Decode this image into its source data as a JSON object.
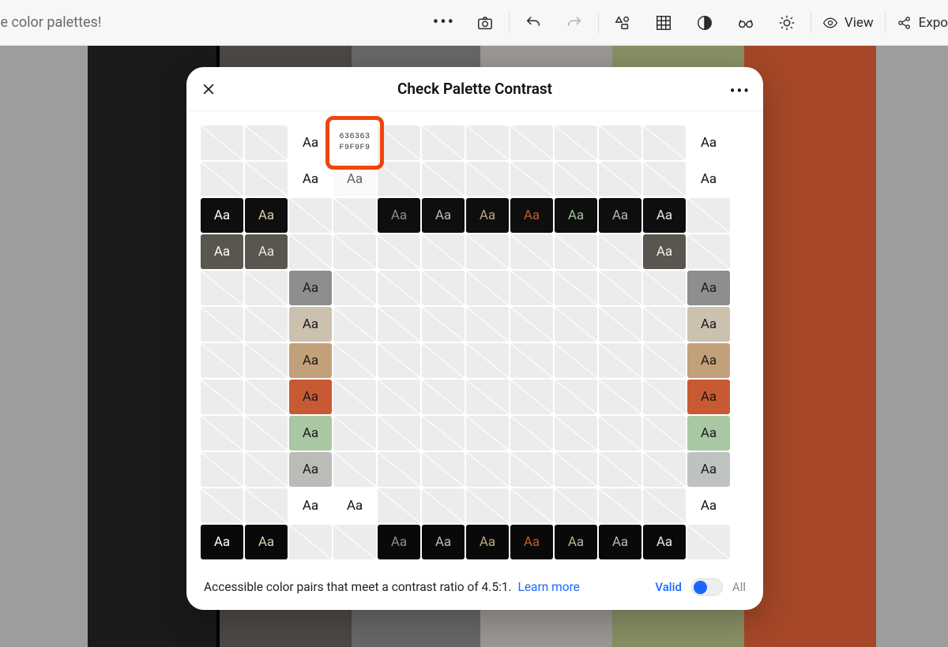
{
  "toolbar": {
    "tagline": "enerate color palettes!",
    "view_label": "View",
    "export_label": "Expo"
  },
  "palette_stripes": [
    {
      "color": "#9d9d9d",
      "width": 111
    },
    {
      "color": "#181a1b",
      "width": 163
    },
    {
      "color": "#000000",
      "width": 4
    },
    {
      "color": "#4c4845",
      "width": 163
    },
    {
      "color": "#464646",
      "width": 4
    },
    {
      "color": "#676767",
      "width": 163
    },
    {
      "color": "#9a9794",
      "width": 167
    },
    {
      "color": "#888f64",
      "width": 167
    },
    {
      "color": "#a54728",
      "width": 167
    },
    {
      "color": "#9d9d9d",
      "width": 120
    }
  ],
  "modal": {
    "title": "Check Palette Contrast",
    "footer_text": "Accessible color pairs that meet a contrast ratio of 4.5:1.",
    "learn_more": "Learn more",
    "valid_label": "Valid",
    "all_label": "All",
    "tooltip": {
      "fg": "636363",
      "bg": "F9F9F9"
    },
    "aa": "Aa"
  },
  "grid": {
    "cols": 12,
    "tooltip_cell": {
      "row": 0,
      "col": 3
    },
    "highlight": {
      "row": 0,
      "col": 3
    },
    "cells": [
      {
        "row": 0,
        "col": 2,
        "bg": "#ffffff",
        "fg": "#111111"
      },
      {
        "row": 0,
        "col": 11,
        "bg": "#ffffff",
        "fg": "#111111"
      },
      {
        "row": 1,
        "col": 2,
        "bg": "#ffffff",
        "fg": "#111111"
      },
      {
        "row": 1,
        "col": 3,
        "bg": "#f9f9f9",
        "fg": "#636363"
      },
      {
        "row": 1,
        "col": 11,
        "bg": "#ffffff",
        "fg": "#111111"
      },
      {
        "row": 2,
        "col": 0,
        "bg": "#0e0e0e",
        "fg": "#ffffff"
      },
      {
        "row": 2,
        "col": 1,
        "bg": "#0e0e0e",
        "fg": "#d8cfa9"
      },
      {
        "row": 2,
        "col": 4,
        "bg": "#0e0e0e",
        "fg": "#8d8d8d"
      },
      {
        "row": 2,
        "col": 5,
        "bg": "#0e0e0e",
        "fg": "#bdbdbd"
      },
      {
        "row": 2,
        "col": 6,
        "bg": "#0e0e0e",
        "fg": "#bfa982"
      },
      {
        "row": 2,
        "col": 7,
        "bg": "#0e0e0e",
        "fg": "#c25a33"
      },
      {
        "row": 2,
        "col": 8,
        "bg": "#0e0e0e",
        "fg": "#a0c09a"
      },
      {
        "row": 2,
        "col": 9,
        "bg": "#0e0e0e",
        "fg": "#b7b7b7"
      },
      {
        "row": 2,
        "col": 10,
        "bg": "#0e0e0e",
        "fg": "#eaeaea"
      },
      {
        "row": 3,
        "col": 0,
        "bg": "#59554f",
        "fg": "#ffffff"
      },
      {
        "row": 3,
        "col": 1,
        "bg": "#59554f",
        "fg": "#e8e8e8"
      },
      {
        "row": 3,
        "col": 10,
        "bg": "#59554f",
        "fg": "#f4f4f4"
      },
      {
        "row": 4,
        "col": 2,
        "bg": "#8e8e8e",
        "fg": "#1a1a1a"
      },
      {
        "row": 4,
        "col": 11,
        "bg": "#8e8e8e",
        "fg": "#1a1a1a"
      },
      {
        "row": 5,
        "col": 2,
        "bg": "#cbc1ae",
        "fg": "#1a1a1a"
      },
      {
        "row": 5,
        "col": 11,
        "bg": "#cbc1ae",
        "fg": "#1a1a1a"
      },
      {
        "row": 6,
        "col": 2,
        "bg": "#c2a079",
        "fg": "#1a1a1a"
      },
      {
        "row": 6,
        "col": 11,
        "bg": "#c2a079",
        "fg": "#1a1a1a"
      },
      {
        "row": 7,
        "col": 2,
        "bg": "#c85a33",
        "fg": "#1a1a1a"
      },
      {
        "row": 7,
        "col": 11,
        "bg": "#c85a33",
        "fg": "#1a1a1a"
      },
      {
        "row": 8,
        "col": 2,
        "bg": "#a8c7a2",
        "fg": "#1a1a1a"
      },
      {
        "row": 8,
        "col": 11,
        "bg": "#a8c7a2",
        "fg": "#1a1a1a"
      },
      {
        "row": 9,
        "col": 2,
        "bg": "#b9bcb7",
        "fg": "#1a1a1a"
      },
      {
        "row": 9,
        "col": 11,
        "bg": "#bfc3c0",
        "fg": "#1a1a1a"
      },
      {
        "row": 10,
        "col": 2,
        "bg": "#ffffff",
        "fg": "#111111"
      },
      {
        "row": 10,
        "col": 3,
        "bg": "#ffffff",
        "fg": "#111111"
      },
      {
        "row": 10,
        "col": 11,
        "bg": "#ffffff",
        "fg": "#111111"
      },
      {
        "row": 11,
        "col": 0,
        "bg": "#090909",
        "fg": "#ffffff"
      },
      {
        "row": 11,
        "col": 1,
        "bg": "#090909",
        "fg": "#d8cfa9"
      },
      {
        "row": 11,
        "col": 4,
        "bg": "#090909",
        "fg": "#8d8d8d"
      },
      {
        "row": 11,
        "col": 5,
        "bg": "#090909",
        "fg": "#bdbdbd"
      },
      {
        "row": 11,
        "col": 6,
        "bg": "#090909",
        "fg": "#bfa982"
      },
      {
        "row": 11,
        "col": 7,
        "bg": "#090909",
        "fg": "#c25a33"
      },
      {
        "row": 11,
        "col": 8,
        "bg": "#090909",
        "fg": "#a0c09a"
      },
      {
        "row": 11,
        "col": 9,
        "bg": "#090909",
        "fg": "#b7b7b7"
      },
      {
        "row": 11,
        "col": 10,
        "bg": "#090909",
        "fg": "#eaeaea"
      }
    ],
    "rows": 12
  }
}
